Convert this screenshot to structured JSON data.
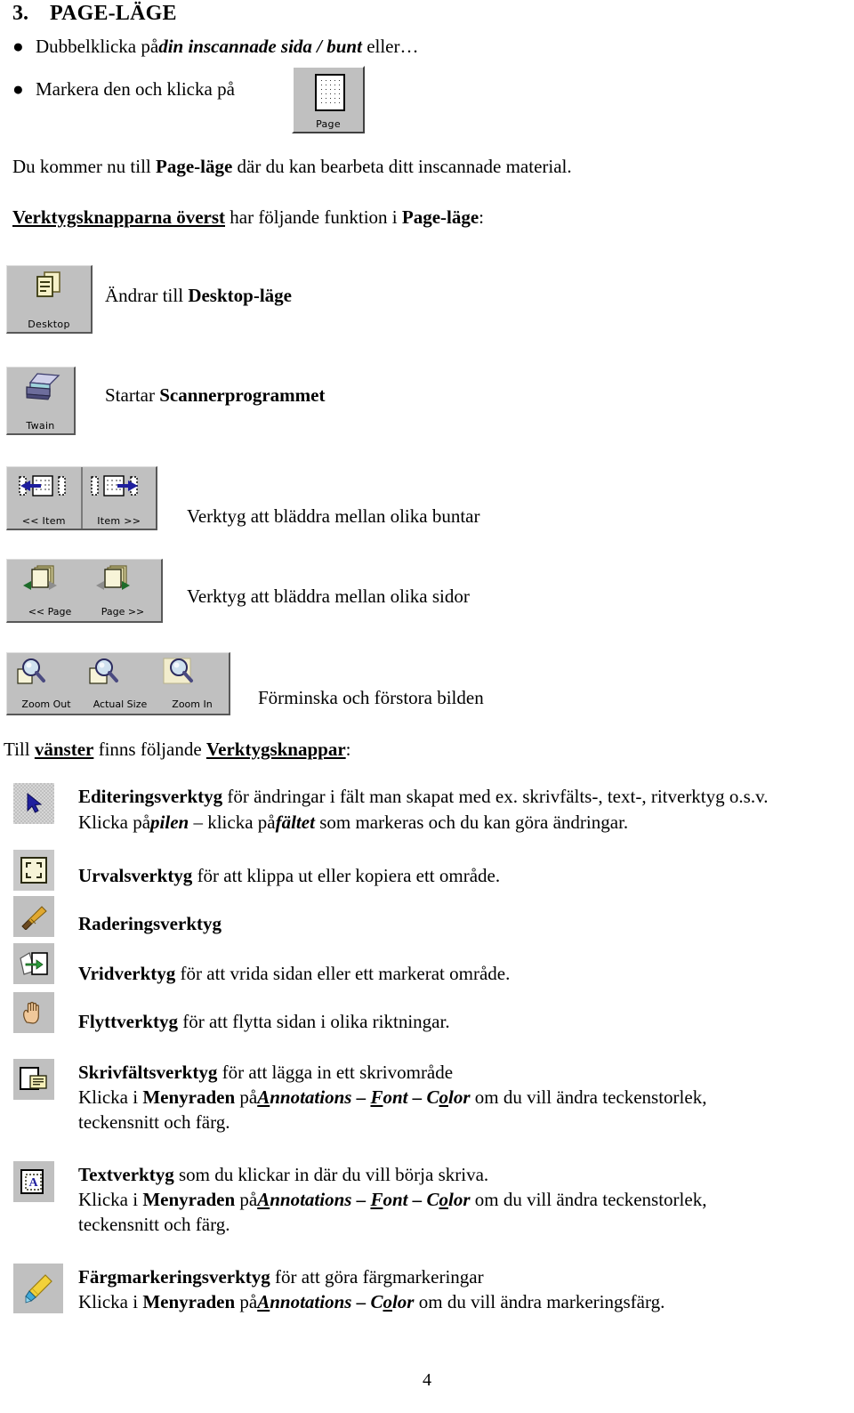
{
  "document": {
    "page_number": "4",
    "heading": {
      "number": "3.",
      "title": "PAGE-LÄGE"
    },
    "bullets": [
      {
        "marker": "●",
        "pre": "Dubbelklicka på",
        "em": "din inscannade sida / bunt",
        "post": " eller…"
      },
      {
        "marker": "●",
        "pre": "Markera den och klicka på",
        "em": "",
        "post": ""
      }
    ],
    "paragraphs": {
      "intro_a": "Du kommer nu till ",
      "intro_b": "Page-läge",
      "intro_c": " där du kan bearbeta ditt inscannade material.",
      "toolbar_a": "Verktygsknapparna överst",
      "toolbar_b": " har följande funktion i ",
      "toolbar_c": "Page-läge",
      "toolbar_d": ":",
      "left_a": "Till ",
      "left_b": "vänster",
      "left_c": " finns följande ",
      "left_d": "Verktygsknappar",
      "left_e": ":"
    },
    "toolbar_buttons": [
      {
        "icon_name": "page-button-icon",
        "caption": "Page",
        "description": ""
      },
      {
        "icon_name": "desktop-button-icon",
        "caption": "Desktop",
        "desc_pre": "Ändrar till ",
        "desc_bold": "Desktop-läge",
        "desc_post": ""
      },
      {
        "icon_name": "twain-scanner-button-icon",
        "caption": "Twain",
        "desc_pre": "Startar ",
        "desc_bold": "Scannerprogrammet",
        "desc_post": ""
      },
      {
        "icon_name": "item-nav-buttons-icon",
        "caption_left": "<< Item",
        "caption_right": "Item >>",
        "description": "Verktyg att bläddra mellan olika buntar"
      },
      {
        "icon_name": "page-nav-buttons-icon",
        "caption_left": "<< Page",
        "caption_right": "Page >>",
        "description": "Verktyg att bläddra mellan olika sidor"
      },
      {
        "icon_name": "zoom-buttons-icon",
        "caption_left": "Zoom Out",
        "caption_mid": "Actual Size",
        "caption_right": "Zoom In",
        "description": "Förminska och förstora bilden"
      }
    ],
    "tools": [
      {
        "icon_name": "arrow-edit-tool-icon",
        "lines": [
          {
            "bold": "Editeringsverktyg",
            "rest": " för ändringar i fält man skapat med ex. skrivfälts-, text-, ritverktyg o.s.v."
          },
          {
            "plain_a": "Klicka på",
            "em_a": "pilen",
            "plain_b": " – klicka på",
            "em_b": "fältet",
            "plain_c": " som markeras och du kan göra ändringar."
          }
        ]
      },
      {
        "icon_name": "marquee-select-tool-icon",
        "lines": [
          {
            "bold": "Urvalsverktyg",
            "rest": " för att klippa ut eller kopiera ett område."
          }
        ]
      },
      {
        "icon_name": "eraser-tool-icon",
        "lines": [
          {
            "bold": "Raderingsverktyg",
            "rest": ""
          }
        ]
      },
      {
        "icon_name": "rotate-tool-icon",
        "lines": [
          {
            "bold": "Vridverktyg",
            "rest": " för att vrida sidan eller ett markerat område."
          }
        ]
      },
      {
        "icon_name": "hand-pan-tool-icon",
        "lines": [
          {
            "bold": "Flyttverktyg",
            "rest": " för att flytta sidan i olika riktningar."
          }
        ]
      },
      {
        "icon_name": "text-field-tool-icon",
        "lines": [
          {
            "bold": "Skrivfältsverktyg",
            "rest": " för att lägga in ett skrivområde"
          },
          {
            "plain_a": "Klicka i ",
            "bold_a": "Menyraden",
            "plain_b": " på",
            "menu1": "Annotations",
            "sep1": " – ",
            "menu2": "Font",
            "sep2": " – ",
            "menu3": "Color",
            "plain_c": " om du vill ändra teckenstorlek,"
          },
          {
            "plain_a": "teckensnitt och färg."
          }
        ]
      },
      {
        "icon_name": "text-annotation-tool-icon",
        "lines": [
          {
            "bold": "Textverktyg",
            "rest": " som du klickar in där du vill börja skriva."
          },
          {
            "plain_a": "Klicka i ",
            "bold_a": "Menyraden",
            "plain_b": " på",
            "menu1": "Annotations",
            "sep1": " – ",
            "menu2": "Font",
            "sep2": " – ",
            "menu3": "Color",
            "plain_c": " om du vill ändra teckenstorlek,"
          },
          {
            "plain_a": "teckensnitt och färg."
          }
        ]
      },
      {
        "icon_name": "highlighter-tool-icon",
        "lines": [
          {
            "bold": "Färgmarkeringsverktyg",
            "rest": " för att göra färgmarkeringar"
          },
          {
            "plain_a": "Klicka i ",
            "bold_a": "Menyraden",
            "plain_b": " på",
            "menu1": "Annotations",
            "sep1": " – ",
            "menu2": "Color",
            "plain_c": " om du vill ändra markeringsfärg."
          }
        ]
      }
    ],
    "colors": {
      "text": "#000000",
      "background": "#ffffff",
      "button_face": "#c0c0c0",
      "icon_blue": "#1f1f9e",
      "icon_paper": "#f5f0c8",
      "highlight_yellow": "#f2d13a"
    }
  }
}
